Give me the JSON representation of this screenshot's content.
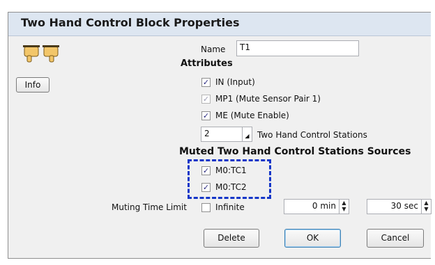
{
  "window": {
    "title": "Two Hand Control Block Properties"
  },
  "left": {
    "info_label": "Info"
  },
  "name": {
    "label": "Name",
    "value": "T1"
  },
  "attributes": {
    "header": "Attributes",
    "items": [
      {
        "label": "IN (Input)",
        "checked": true,
        "enabled": true
      },
      {
        "label": "MP1 (Mute Sensor Pair 1)",
        "checked": true,
        "enabled": false
      },
      {
        "label": "ME (Mute Enable)",
        "checked": true,
        "enabled": true
      }
    ],
    "stations_value": "2",
    "stations_label": "Two Hand Control Stations"
  },
  "muted": {
    "header": "Muted Two Hand Control Stations Sources",
    "items": [
      {
        "label": "M0:TC1",
        "checked": true
      },
      {
        "label": "M0:TC2",
        "checked": true
      }
    ]
  },
  "muting": {
    "label": "Muting Time Limit",
    "infinite_label": "Infinite",
    "minutes": "0 min",
    "seconds": "30 sec"
  },
  "buttons": {
    "delete": "Delete",
    "ok": "OK",
    "cancel": "Cancel"
  },
  "icons": {
    "checkmark": "✓",
    "hands": "two-hands-icon"
  },
  "colors": {
    "highlight_dash": "#1436c8",
    "titlebar": "#dde6f1"
  }
}
